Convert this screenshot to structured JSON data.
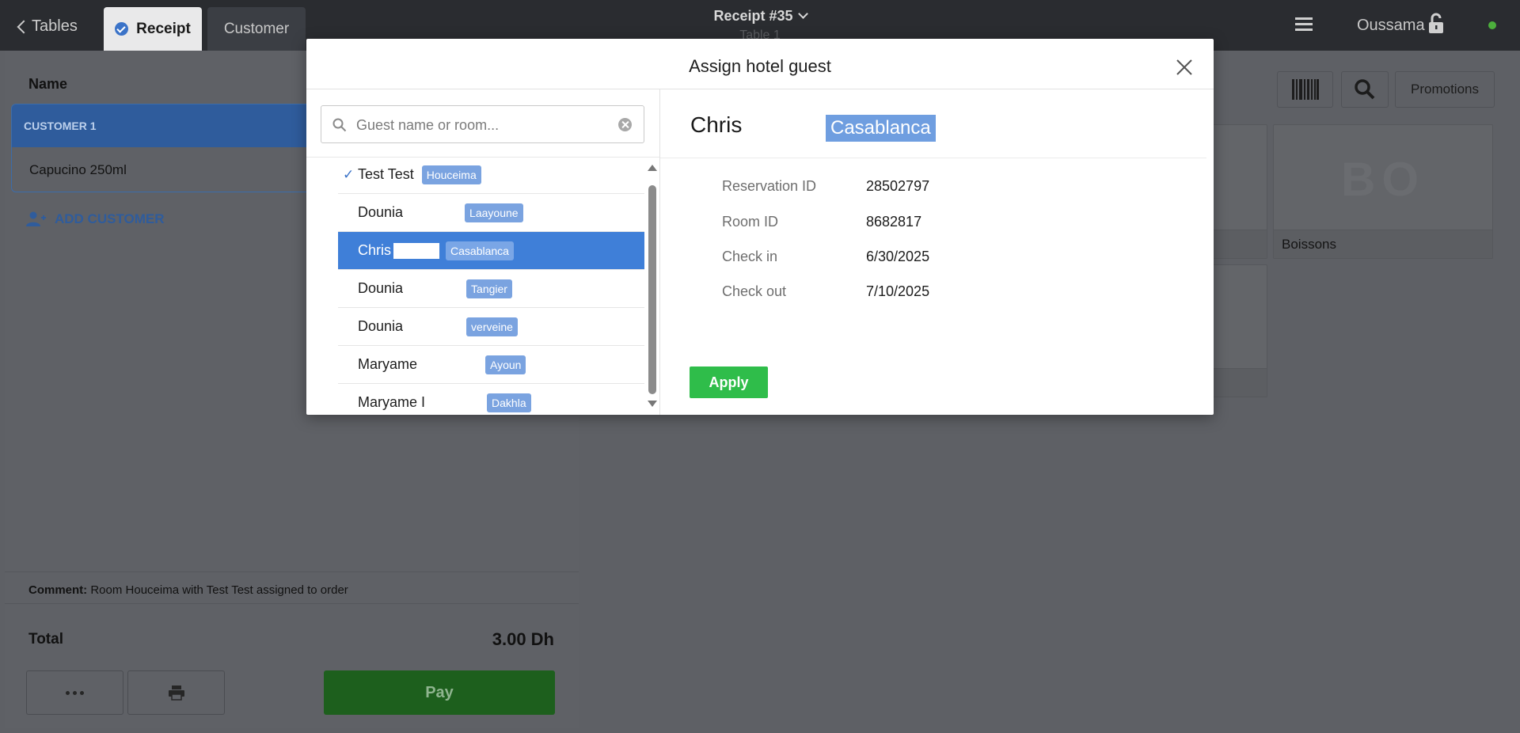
{
  "topbar": {
    "back_label": "Tables",
    "tabs": [
      {
        "label": "Receipt"
      },
      {
        "label": "Customer"
      }
    ],
    "receipt_title": "Receipt #35",
    "table_label": "Table 1",
    "user_name": "Oussama",
    "status_color": "#4caf3c"
  },
  "left_panel": {
    "name_header": "Name",
    "customer": {
      "label": "CUSTOMER 1",
      "items": [
        "Capucino 250ml"
      ]
    },
    "add_customer_label": "ADD CUSTOMER",
    "comment_label": "Comment:",
    "comment_text": "Room Houceima with Test Test assigned to order",
    "total_label": "Total",
    "total_value": "3.00 Dh",
    "pay_label": "Pay"
  },
  "product_area": {
    "promotions_label": "Promotions",
    "tiles": [
      {
        "abbr": "BO",
        "label": "Boissons"
      }
    ]
  },
  "modal": {
    "title": "Assign hotel guest",
    "search_placeholder": "Guest name or room...",
    "search_value": "",
    "guests": [
      {
        "name": "Test Test",
        "room": "Houceima",
        "checked": true,
        "selected": false
      },
      {
        "name": "Dounia",
        "room": "Laayoune",
        "checked": false,
        "selected": false
      },
      {
        "name": "Chris",
        "room": "Casablanca",
        "checked": false,
        "selected": true
      },
      {
        "name": "Dounia",
        "room": "Tangier",
        "checked": false,
        "selected": false
      },
      {
        "name": "Dounia",
        "room": "verveine",
        "checked": false,
        "selected": false
      },
      {
        "name": "Maryame",
        "room": "Ayoun",
        "checked": false,
        "selected": false
      },
      {
        "name": "Maryame I",
        "room": "Dakhla",
        "checked": false,
        "selected": false
      }
    ],
    "detail": {
      "name": "Chris",
      "room": "Casablanca",
      "fields": [
        {
          "label": "Reservation ID",
          "value": "28502797"
        },
        {
          "label": "Room ID",
          "value": "8682817"
        },
        {
          "label": "Check in",
          "value": "6/30/2025"
        },
        {
          "label": "Check out",
          "value": "7/10/2025"
        }
      ]
    },
    "apply_label": "Apply"
  },
  "colors": {
    "accent_blue": "#3f7fd8",
    "tag_blue": "#7aa3e0",
    "apply_green": "#2fbd4a",
    "pay_green": "#1d5f1d",
    "overlay_bg": "#5e6065"
  }
}
